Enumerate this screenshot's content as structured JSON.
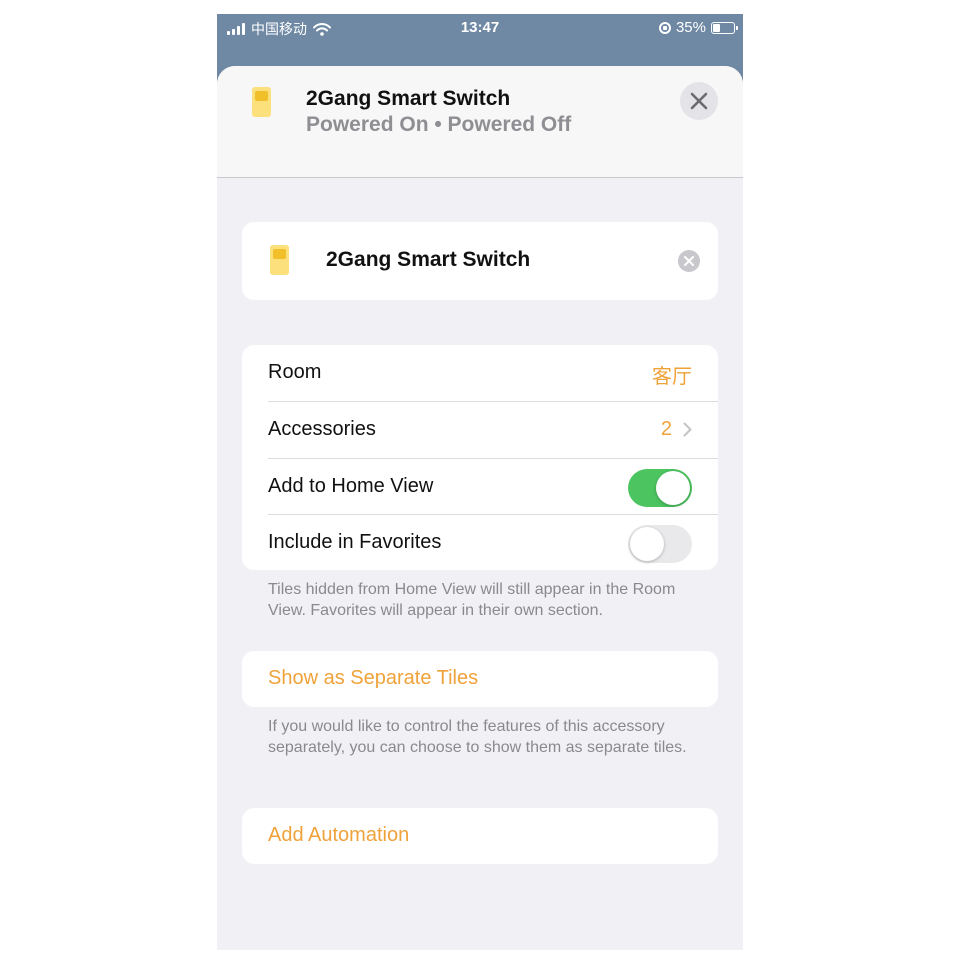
{
  "status_bar": {
    "carrier": "中国移动",
    "time": "13:47",
    "battery": "35%"
  },
  "header": {
    "title": "2Gang Smart Switch",
    "subtitle": "Powered On • Powered Off"
  },
  "name_field": {
    "value": "2Gang Smart Switch"
  },
  "settings": {
    "room_label": "Room",
    "room_value": "客厅",
    "accessories_label": "Accessories",
    "accessories_value": "2",
    "home_view_label": "Add to Home View",
    "home_view_on": true,
    "favorites_label": "Include in Favorites",
    "favorites_on": false
  },
  "footnote_tiles": "Tiles hidden from Home View will still appear in the Room View. Favorites will appear in their own section.",
  "separate_tiles": {
    "label": "Show as Separate Tiles",
    "footnote": "If you would like to control the features of this accessory separately, you can choose to show them as separate tiles."
  },
  "automation": {
    "label": "Add Automation"
  },
  "colors": {
    "accent": "#f0a23a",
    "toggle_on": "#4cc460",
    "status_bar_bg": "#6f89a4"
  },
  "icons": {
    "device": "light-switch-icon",
    "close": "close-icon",
    "clear": "clear-circle-icon",
    "disclosure": "chevron-right-icon"
  }
}
